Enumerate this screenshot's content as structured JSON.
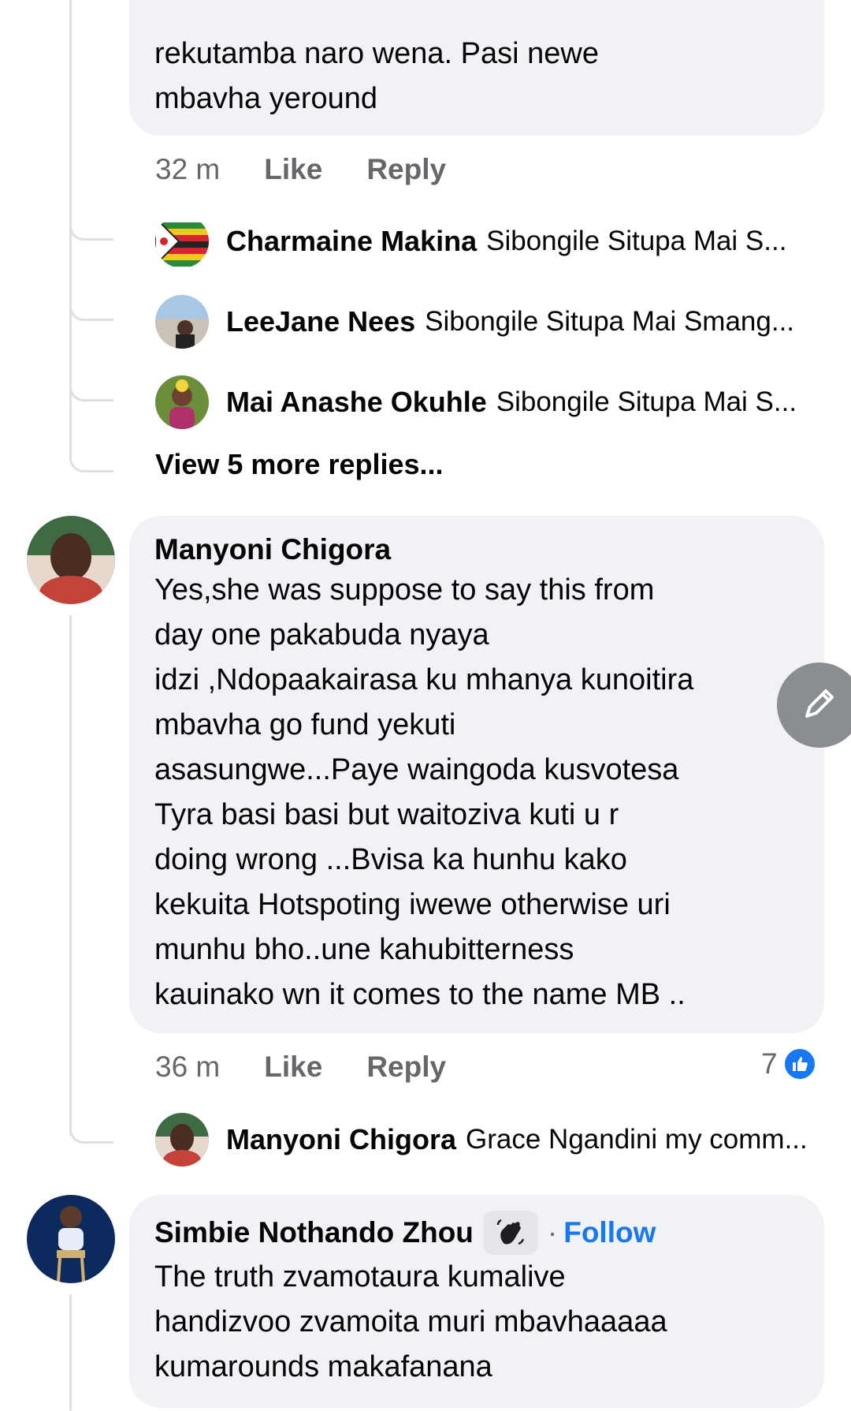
{
  "comment1": {
    "text_line1": "rekutamba naro wena. Pasi newe",
    "text_line2": "mbavha yeround",
    "time": "32 m",
    "like": "Like",
    "reply": "Reply"
  },
  "replies1": [
    {
      "name": "Charmaine Makina",
      "snippet": "Sibongile Situpa Mai S..."
    },
    {
      "name": "LeeJane Nees",
      "snippet": "Sibongile Situpa Mai Smang..."
    },
    {
      "name": "Mai Anashe Okuhle",
      "snippet": "Sibongile Situpa Mai S..."
    }
  ],
  "view_more": "View 5 more replies...",
  "comment2": {
    "author": "Manyoni Chigora",
    "lines": [
      "Yes,she was suppose to say this from",
      "day one pakabuda nyaya",
      "idzi ,Ndopaakairasa ku mhanya kunoitira",
      "mbavha go fund yekuti",
      "asasungwe...Paye waingoda kusvotesa",
      "Tyra basi basi but waitoziva kuti u r",
      "doing wrong ...Bvisa ka hunhu kako",
      "kekuita Hotspoting iwewe otherwise uri",
      "munhu bho..une kahubitterness",
      "kauinako wn it comes to the name MB .."
    ],
    "time": "36 m",
    "like": "Like",
    "reply": "Reply",
    "like_count": "7"
  },
  "replies2": [
    {
      "name": "Manyoni Chigora",
      "snippet": "Grace Ngandini my comm..."
    }
  ],
  "comment3": {
    "author": "Simbie Nothando Zhou",
    "separator": "·",
    "follow": "Follow",
    "lines": [
      "The truth zvamotaura kumalive",
      "handizvoo zvamoita muri mbavhaaaaa",
      "kumarounds makafanana"
    ]
  },
  "colors": {
    "bubble": "#f0f2f5",
    "link": "#1877f2",
    "secondary_text": "#65676b",
    "thread_line": "#dddfe3"
  }
}
